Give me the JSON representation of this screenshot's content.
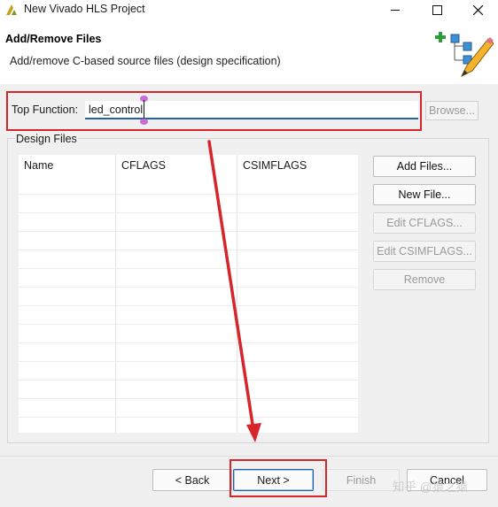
{
  "window": {
    "title": "New Vivado HLS Project",
    "controls": [
      "minimize",
      "maximize",
      "close"
    ]
  },
  "header": {
    "title": "Add/Remove Files",
    "description": "Add/remove C-based source files (design specification)"
  },
  "top_function": {
    "label": "Top Function:",
    "value": "led_control",
    "browse_label": "Browse..."
  },
  "design_files": {
    "group_label": "Design Files",
    "columns": [
      "Name",
      "CFLAGS",
      "CSIMFLAGS"
    ],
    "rows": []
  },
  "side_buttons": {
    "add_files": "Add Files...",
    "new_file": "New File...",
    "edit_cflags": "Edit CFLAGS...",
    "edit_csimflags": "Edit CSIMFLAGS...",
    "remove": "Remove"
  },
  "footer": {
    "back": "< Back",
    "next": "Next >",
    "finish": "Finish",
    "cancel": "Cancel"
  },
  "watermark": "知乎 @猿之猿",
  "colors": {
    "highlight": "#d6262c",
    "focus": "#1f5fa8",
    "cursor_handles": "#c86dd7"
  }
}
